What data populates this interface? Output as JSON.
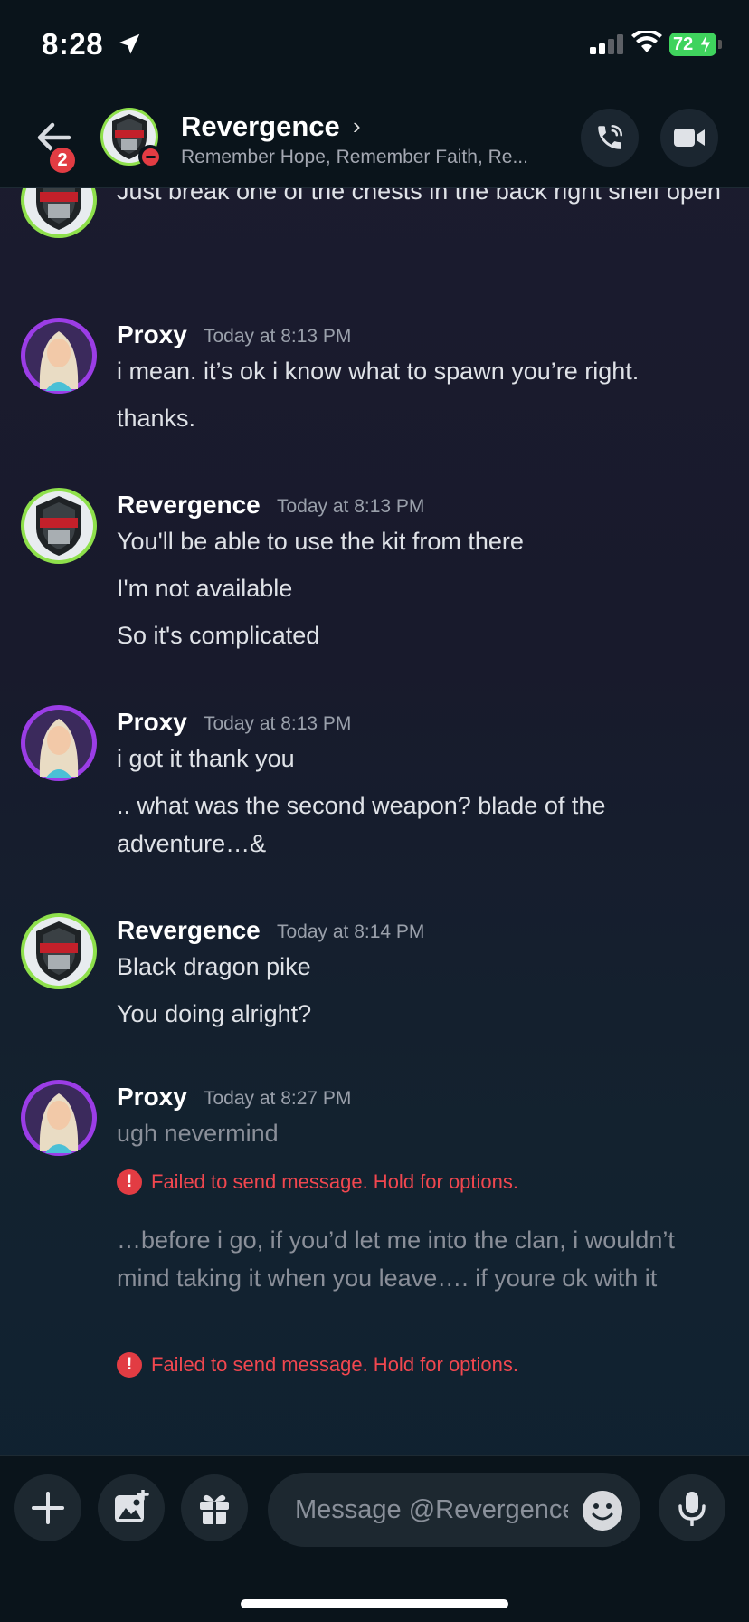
{
  "status_bar": {
    "time": "8:28",
    "battery": "72"
  },
  "header": {
    "back_badge": "2",
    "name": "Revergence",
    "chevron": "›",
    "status": "Remember Hope, Remember Faith, Re..."
  },
  "messages": [
    {
      "author": "Revergence",
      "time": "",
      "partial": true,
      "lines": [
        "Just break one of the chests in the back right shelf open"
      ]
    },
    {
      "author": "Proxy",
      "time": "Today at 8:13 PM",
      "lines": [
        "i mean. it’s ok i know what to spawn you’re right.",
        "thanks."
      ]
    },
    {
      "author": "Revergence",
      "time": "Today at 8:13 PM",
      "lines": [
        "You'll be able to use the kit from there",
        "I'm not available",
        "So it's complicated"
      ]
    },
    {
      "author": "Proxy",
      "time": "Today at 8:13 PM",
      "lines": [
        "i got it thank you",
        ".. what was the second weapon? blade of the adventure…&"
      ]
    },
    {
      "author": "Revergence",
      "time": "Today at 8:14 PM",
      "lines": [
        "Black dragon pike",
        "You doing alright?"
      ]
    },
    {
      "author": "Proxy",
      "time": "Today at 8:27 PM",
      "lines": [
        "ugh nevermind",
        "…before i go, if you’d let me into the clan, i wouldn’t mind taking it when you leave…. if youre ok with it"
      ],
      "error": "Failed to send message. Hold for options."
    }
  ],
  "composer": {
    "placeholder": "Message @Revergence"
  },
  "colors": {
    "background": "#181a2c",
    "bar": "#0a141b",
    "error": "#f0474f",
    "proxy_ring": "#9b3de6",
    "revergence_ring": "#8ee04b"
  }
}
